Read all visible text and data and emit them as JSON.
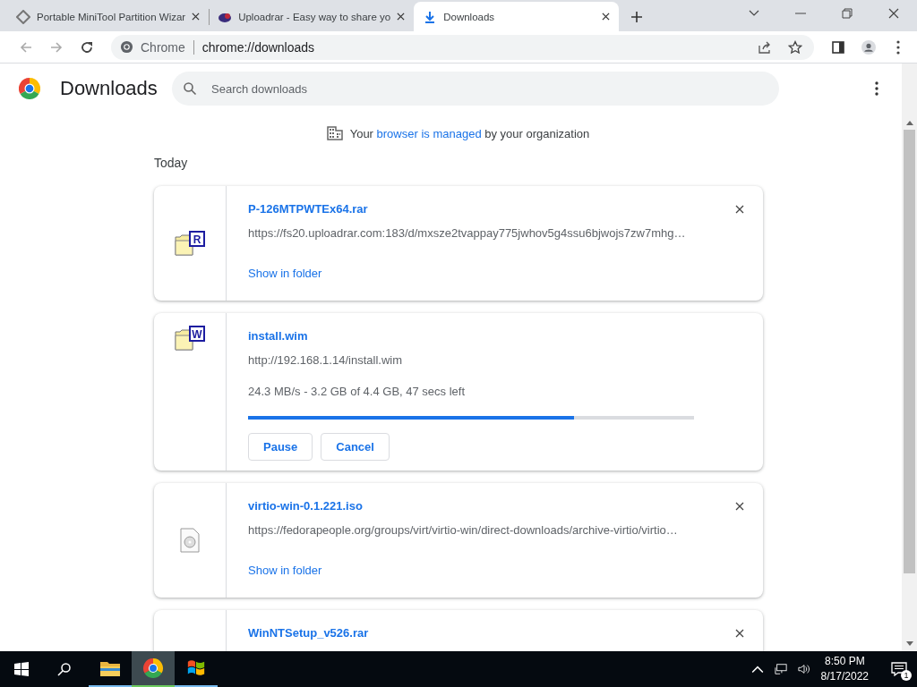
{
  "tabs": [
    {
      "title": "Portable MiniTool Partition Wizar",
      "selected": false,
      "kind": "diamond"
    },
    {
      "title": "Uploadrar - Easy way to share yo",
      "selected": false,
      "kind": "cloud"
    },
    {
      "title": "Downloads",
      "selected": true,
      "kind": "download"
    }
  ],
  "address": {
    "site": "Chrome",
    "url": "chrome://downloads"
  },
  "page": {
    "title": "Downloads",
    "search": {
      "placeholder": "Search downloads"
    }
  },
  "managed_notice": {
    "before": "Your",
    "link": "browser is managed",
    "after": "by your organization"
  },
  "section": "Today",
  "downloads": [
    {
      "kind": "done",
      "badge": "R",
      "name": "P-126MTPWTEx64.rar",
      "url": "https://fs20.uploadrar.com:183/d/mxsze2tvappay775jwhov5g4ssu6bjwojs7zw7mhg…",
      "link": "Show in folder"
    },
    {
      "kind": "progress",
      "badge": "W",
      "name": "install.wim",
      "url": "http://192.168.1.14/install.wim",
      "status": "24.3 MB/s - 3.2 GB of 4.4 GB, 47 secs left",
      "level": 0.73,
      "buttons": [
        "Pause",
        "Cancel"
      ]
    },
    {
      "kind": "done",
      "name": "virtio-win-0.1.221.iso",
      "url": "https://fedorapeople.org/groups/virt/virtio-win/direct-downloads/archive-virtio/virtio…",
      "link": "Show in folder"
    },
    {
      "kind": "cut",
      "name": "WinNTSetup_v526.rar"
    }
  ],
  "taskbar": {
    "clock": {
      "time": "8:50 PM",
      "date": "8/17/2022"
    },
    "notifications": "1"
  }
}
